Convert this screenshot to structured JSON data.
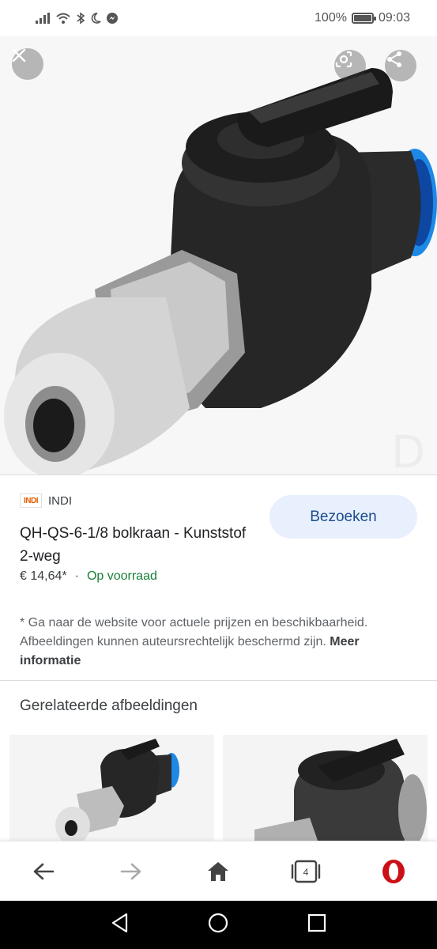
{
  "status_bar": {
    "battery": "100%",
    "time": "09:03"
  },
  "product": {
    "source_logo": "INDI",
    "source_name": "INDI",
    "title": "QH-QS-6-1/8 bolkraan - Kunststof 2-weg",
    "price": "€ 14,64*",
    "separator": "·",
    "availability": "Op voorraad",
    "visit_label": "Bezoeken"
  },
  "disclaimer": {
    "text": "* Ga naar de website voor actuele prijzen en beschikbaarheid. Afbeeldingen kunnen auteursrechtelijk beschermd zijn. ",
    "link": "Meer informatie"
  },
  "related": {
    "heading": "Gerelateerde afbeeldingen"
  },
  "browser_bar": {
    "tab_count": "4"
  },
  "colors": {
    "accent": "#1a73e8",
    "stock_green": "#188038",
    "visit_bg": "#e8f0fe",
    "opera_red": "#cc0f16"
  }
}
